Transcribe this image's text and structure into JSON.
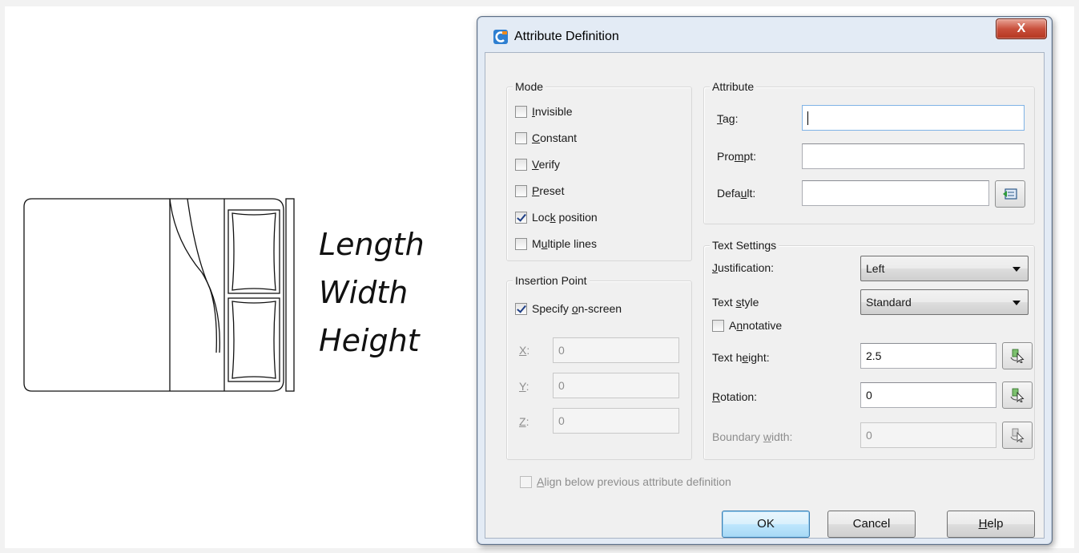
{
  "drawing": {
    "dimension_labels": [
      "Length",
      "Width",
      "Height"
    ]
  },
  "dialog": {
    "title": "Attribute Definition",
    "close_glyph": "X",
    "mode": {
      "title": "Mode",
      "invisible": {
        "label": "Invisible",
        "checked": false
      },
      "constant": {
        "label": "Constant",
        "checked": false
      },
      "verify": {
        "label": "Verify",
        "checked": false
      },
      "preset": {
        "label": "Preset",
        "checked": false
      },
      "lock_position": {
        "label": "Lock position",
        "checked": true
      },
      "multiple_lines": {
        "label": "Multiple lines",
        "checked": false
      }
    },
    "attribute": {
      "title": "Attribute",
      "tag_label": "Tag:",
      "tag_value": "",
      "prompt_label": "Prompt:",
      "prompt_value": "",
      "default_label": "Default:",
      "default_value": ""
    },
    "insertion_point": {
      "title": "Insertion Point",
      "specify_on_screen": {
        "label": "Specify on-screen",
        "checked": true
      },
      "x_label": "X:",
      "x_value": "0",
      "y_label": "Y:",
      "y_value": "0",
      "z_label": "Z:",
      "z_value": "0"
    },
    "text_settings": {
      "title": "Text Settings",
      "justification_label": "Justification:",
      "justification_value": "Left",
      "text_style_label": "Text style",
      "text_style_value": "Standard",
      "annotative": {
        "label": "Annotative",
        "checked": false
      },
      "text_height_label": "Text height:",
      "text_height_value": "2.5",
      "rotation_label": "Rotation:",
      "rotation_value": "0",
      "boundary_width_label": "Boundary width:",
      "boundary_width_value": "0"
    },
    "align_below": {
      "label": "Align below previous attribute definition",
      "checked": false
    },
    "buttons": {
      "ok": "OK",
      "cancel": "Cancel",
      "help": "Help"
    }
  }
}
